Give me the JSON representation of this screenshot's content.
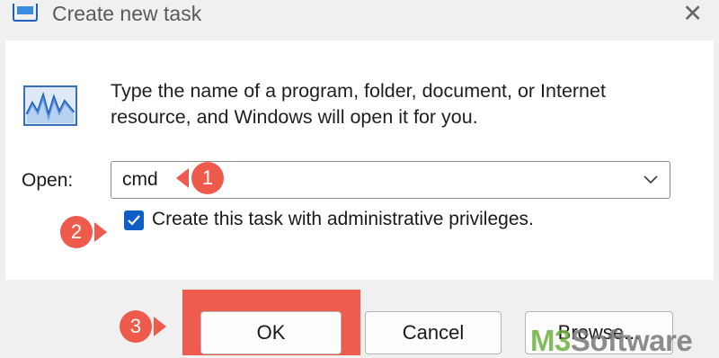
{
  "window": {
    "title": "Create new task",
    "app_icon": "task-manager-icon",
    "close_icon": "close-icon"
  },
  "prompt": {
    "icon": "performance-graph-icon",
    "text": "Type the name of a program, folder, document, or Internet resource, and Windows will open it for you."
  },
  "open_field": {
    "label": "Open:",
    "value": "cmd"
  },
  "admin_checkbox": {
    "label": "Create this task with administrative privileges.",
    "checked": true
  },
  "buttons": {
    "ok": "OK",
    "cancel": "Cancel",
    "browse": "Browse..."
  },
  "annotations": [
    "1",
    "2",
    "3"
  ],
  "watermark": {
    "text": "M3 Software",
    "brand_prefix": "M3",
    "rest": "Software"
  },
  "colors": {
    "accent": "#0f5ec5",
    "annotation": "#ee5a4b",
    "watermark_green": "#6db33f"
  }
}
